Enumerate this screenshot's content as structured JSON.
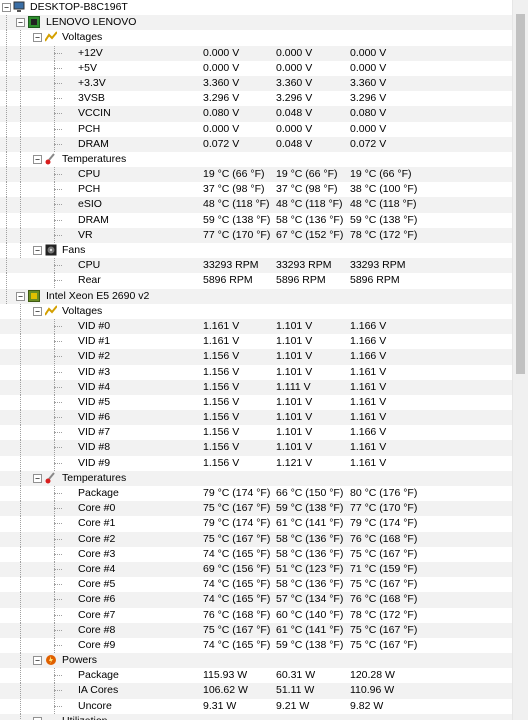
{
  "computer": "DESKTOP-B8C196T",
  "mainboard": {
    "name": "LENOVO LENOVO",
    "voltages": {
      "label": "Voltages",
      "rows": [
        [
          "+12V",
          "0.000 V",
          "0.000 V",
          "0.000 V"
        ],
        [
          "+5V",
          "0.000 V",
          "0.000 V",
          "0.000 V"
        ],
        [
          "+3.3V",
          "3.360 V",
          "3.360 V",
          "3.360 V"
        ],
        [
          "3VSB",
          "3.296 V",
          "3.296 V",
          "3.296 V"
        ],
        [
          "VCCIN",
          "0.080 V",
          "0.048 V",
          "0.080 V"
        ],
        [
          "PCH",
          "0.000 V",
          "0.000 V",
          "0.000 V"
        ],
        [
          "DRAM",
          "0.072 V",
          "0.048 V",
          "0.072 V"
        ]
      ]
    },
    "temperatures": {
      "label": "Temperatures",
      "rows": [
        [
          "CPU",
          "19 °C  (66 °F)",
          "19 °C  (66 °F)",
          "19 °C  (66 °F)"
        ],
        [
          "PCH",
          "37 °C  (98 °F)",
          "37 °C  (98 °F)",
          "38 °C  (100 °F)"
        ],
        [
          "eSIO",
          "48 °C  (118 °F)",
          "48 °C  (118 °F)",
          "48 °C  (118 °F)"
        ],
        [
          "DRAM",
          "59 °C  (138 °F)",
          "58 °C  (136 °F)",
          "59 °C  (138 °F)"
        ],
        [
          "VR",
          "77 °C  (170 °F)",
          "67 °C  (152 °F)",
          "78 °C  (172 °F)"
        ]
      ]
    },
    "fans": {
      "label": "Fans",
      "rows": [
        [
          "CPU",
          "33293 RPM",
          "33293 RPM",
          "33293 RPM"
        ],
        [
          "Rear",
          "5896 RPM",
          "5896 RPM",
          "5896 RPM"
        ]
      ]
    }
  },
  "cpu": {
    "name": "Intel Xeon E5 2690 v2",
    "voltages": {
      "label": "Voltages",
      "rows": [
        [
          "VID #0",
          "1.161 V",
          "1.101 V",
          "1.166 V"
        ],
        [
          "VID #1",
          "1.161 V",
          "1.101 V",
          "1.166 V"
        ],
        [
          "VID #2",
          "1.156 V",
          "1.101 V",
          "1.166 V"
        ],
        [
          "VID #3",
          "1.156 V",
          "1.101 V",
          "1.161 V"
        ],
        [
          "VID #4",
          "1.156 V",
          "1.111 V",
          "1.161 V"
        ],
        [
          "VID #5",
          "1.156 V",
          "1.101 V",
          "1.161 V"
        ],
        [
          "VID #6",
          "1.156 V",
          "1.101 V",
          "1.161 V"
        ],
        [
          "VID #7",
          "1.156 V",
          "1.101 V",
          "1.166 V"
        ],
        [
          "VID #8",
          "1.156 V",
          "1.101 V",
          "1.161 V"
        ],
        [
          "VID #9",
          "1.156 V",
          "1.121 V",
          "1.161 V"
        ]
      ]
    },
    "temperatures": {
      "label": "Temperatures",
      "rows": [
        [
          "Package",
          "79 °C  (174 °F)",
          "66 °C  (150 °F)",
          "80 °C  (176 °F)"
        ],
        [
          "Core #0",
          "75 °C  (167 °F)",
          "59 °C  (138 °F)",
          "77 °C  (170 °F)"
        ],
        [
          "Core #1",
          "79 °C  (174 °F)",
          "61 °C  (141 °F)",
          "79 °C  (174 °F)"
        ],
        [
          "Core #2",
          "75 °C  (167 °F)",
          "58 °C  (136 °F)",
          "76 °C  (168 °F)"
        ],
        [
          "Core #3",
          "74 °C  (165 °F)",
          "58 °C  (136 °F)",
          "75 °C  (167 °F)"
        ],
        [
          "Core #4",
          "69 °C  (156 °F)",
          "51 °C  (123 °F)",
          "71 °C  (159 °F)"
        ],
        [
          "Core #5",
          "74 °C  (165 °F)",
          "58 °C  (136 °F)",
          "75 °C  (167 °F)"
        ],
        [
          "Core #6",
          "74 °C  (165 °F)",
          "57 °C  (134 °F)",
          "76 °C  (168 °F)"
        ],
        [
          "Core #7",
          "76 °C  (168 °F)",
          "60 °C  (140 °F)",
          "78 °C  (172 °F)"
        ],
        [
          "Core #8",
          "75 °C  (167 °F)",
          "61 °C  (141 °F)",
          "75 °C  (167 °F)"
        ],
        [
          "Core #9",
          "74 °C  (165 °F)",
          "59 °C  (138 °F)",
          "75 °C  (167 °F)"
        ]
      ]
    },
    "powers": {
      "label": "Powers",
      "rows": [
        [
          "Package",
          "115.93 W",
          "60.31 W",
          "120.28 W"
        ],
        [
          "IA Cores",
          "106.62 W",
          "51.11 W",
          "110.96 W"
        ],
        [
          "Uncore",
          "9.31 W",
          "9.21 W",
          "9.82 W"
        ]
      ]
    },
    "utilization": {
      "label": "Utilization"
    }
  },
  "colors": {
    "alt_row": "#f2f2f2",
    "voltage_icon": "#d4a000",
    "temp_icon": "#d81e1e",
    "power_icon": "#e06000",
    "chip_icon": "#2f8f2f"
  },
  "icons": {
    "computer": "computer-icon",
    "mainboard": "mainboard-icon",
    "cpu": "cpu-chip-icon",
    "voltages": "voltage-icon",
    "temperatures": "thermometer-icon",
    "fans": "fan-icon",
    "powers": "power-icon"
  }
}
